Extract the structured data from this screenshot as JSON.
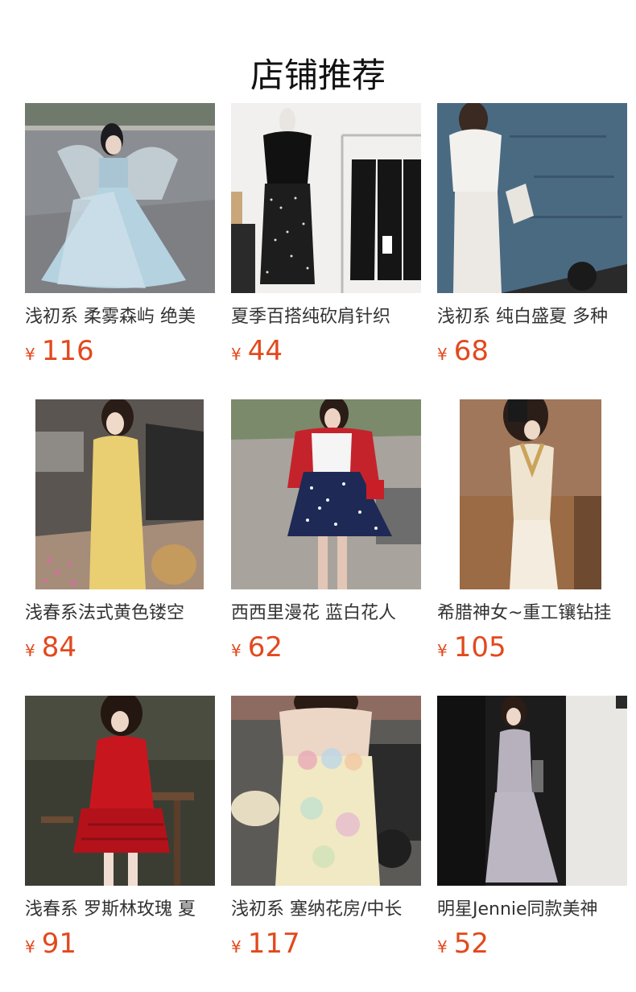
{
  "header": {
    "title": "店铺推荐"
  },
  "currency_symbol": "¥",
  "products": [
    {
      "name": "浅初系 柔雾森屿 绝美",
      "price": "116",
      "image_icon": "photo-woman-light-blue-gown"
    },
    {
      "name": "夏季百搭纯砍肩针织",
      "price": "44",
      "image_icon": "photo-black-top-polka-skirt-rack"
    },
    {
      "name": "浅初系 纯白盛夏 多种",
      "price": "68",
      "image_icon": "photo-woman-white-outfit-by-lake"
    },
    {
      "name": "浅春系法式黄色镂空",
      "price": "84",
      "image_icon": "photo-woman-yellow-dress"
    },
    {
      "name": "西西里漫花 蓝白花人",
      "price": "62",
      "image_icon": "photo-woman-red-cardigan-polka-skirt"
    },
    {
      "name": "希腊神女~重工镶钻挂",
      "price": "105",
      "image_icon": "photo-woman-cream-halter-dress"
    },
    {
      "name": "浅春系 罗斯林玫瑰 夏",
      "price": "91",
      "image_icon": "photo-woman-red-ruffle-dress"
    },
    {
      "name": "浅初系 塞纳花房/中长",
      "price": "117",
      "image_icon": "photo-woman-floral-slip-dress"
    },
    {
      "name": "明星Jennie同款美神",
      "price": "52",
      "image_icon": "photo-woman-grey-knit-set"
    }
  ],
  "colors": {
    "price": "#e2491d",
    "title": "#111111",
    "name": "#333333"
  }
}
